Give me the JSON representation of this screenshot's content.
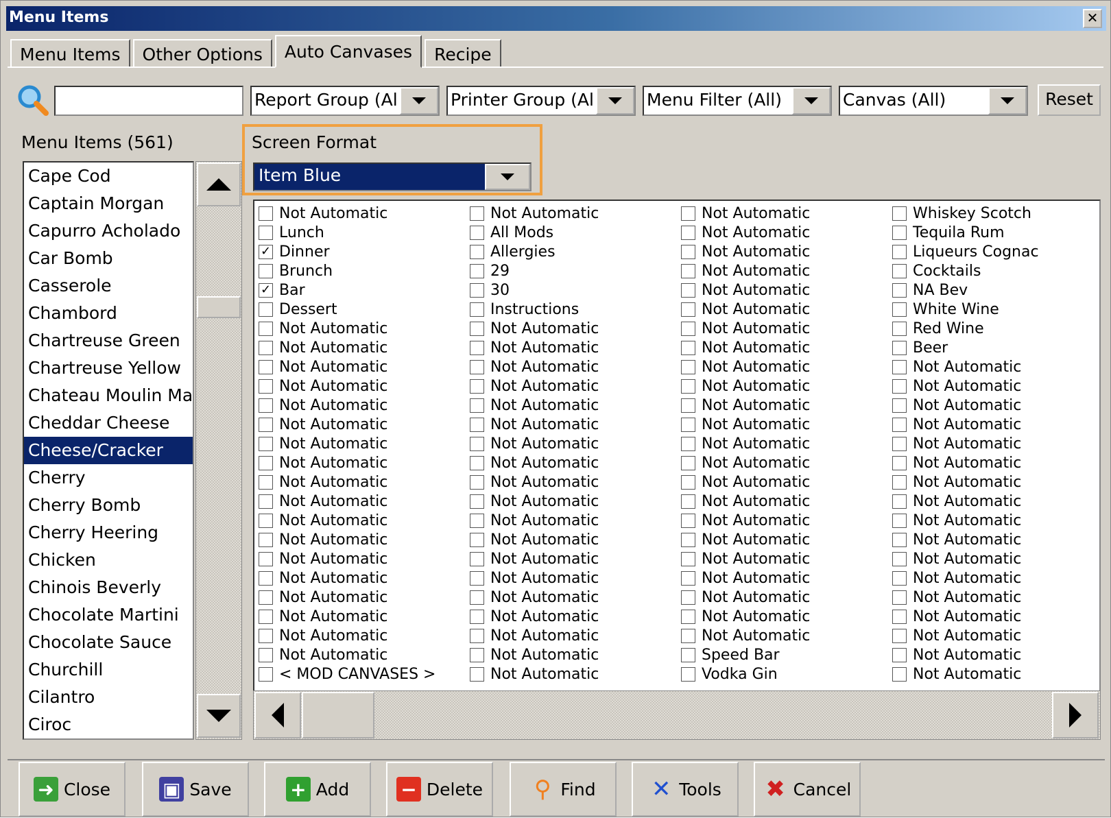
{
  "window": {
    "title": "Menu Items",
    "close_glyph": "✕"
  },
  "tabs": [
    "Menu Items",
    "Other Options",
    "Auto Canvases",
    "Recipe"
  ],
  "active_tab": "Auto Canvases",
  "filters": {
    "search_value": "",
    "report_group": "Report Group (Al",
    "printer_group": "Printer Group (Al",
    "menu_filter": "Menu Filter (All)",
    "canvas": "Canvas (All)",
    "reset": "Reset"
  },
  "menu_items_label": "Menu Items  (561)",
  "menu_items": [
    "Cape Cod",
    "Captain Morgan",
    "Capurro Acholado",
    "Car Bomb",
    "Casserole",
    "Chambord",
    "Chartreuse Green",
    "Chartreuse Yellow",
    "Chateau Moulin Marg",
    "Cheddar Cheese",
    "Cheese/Cracker",
    "Cherry",
    "Cherry Bomb",
    "Cherry Heering",
    "Chicken",
    "Chinois Beverly",
    "Chocolate Martini",
    "Chocolate Sauce",
    "Churchill",
    "Cilantro",
    "Ciroc"
  ],
  "selected_item": "Cheese/Cracker",
  "screen_format": {
    "label": "Screen Format",
    "value": "Item Blue",
    "highlight_color": "#f0a040"
  },
  "canvas_columns": [
    [
      {
        "label": "Not Automatic",
        "checked": false
      },
      {
        "label": "Lunch",
        "checked": false
      },
      {
        "label": "Dinner",
        "checked": true
      },
      {
        "label": "Brunch",
        "checked": false
      },
      {
        "label": "Bar",
        "checked": true
      },
      {
        "label": "Dessert",
        "checked": false
      },
      {
        "label": "Not Automatic",
        "checked": false
      },
      {
        "label": "Not Automatic",
        "checked": false
      },
      {
        "label": "Not Automatic",
        "checked": false
      },
      {
        "label": "Not Automatic",
        "checked": false
      },
      {
        "label": "Not Automatic",
        "checked": false
      },
      {
        "label": "Not Automatic",
        "checked": false
      },
      {
        "label": "Not Automatic",
        "checked": false
      },
      {
        "label": "Not Automatic",
        "checked": false
      },
      {
        "label": "Not Automatic",
        "checked": false
      },
      {
        "label": "Not Automatic",
        "checked": false
      },
      {
        "label": "Not Automatic",
        "checked": false
      },
      {
        "label": "Not Automatic",
        "checked": false
      },
      {
        "label": "Not Automatic",
        "checked": false
      },
      {
        "label": "Not Automatic",
        "checked": false
      },
      {
        "label": "Not Automatic",
        "checked": false
      },
      {
        "label": "Not Automatic",
        "checked": false
      },
      {
        "label": "Not Automatic",
        "checked": false
      },
      {
        "label": "Not Automatic",
        "checked": false
      },
      {
        "label": "< MOD CANVASES >",
        "checked": false
      }
    ],
    [
      {
        "label": "Not Automatic",
        "checked": false
      },
      {
        "label": "All Mods",
        "checked": false
      },
      {
        "label": "Allergies",
        "checked": false
      },
      {
        "label": "29",
        "checked": false
      },
      {
        "label": "30",
        "checked": false
      },
      {
        "label": "Instructions",
        "checked": false
      },
      {
        "label": "Not Automatic",
        "checked": false
      },
      {
        "label": "Not Automatic",
        "checked": false
      },
      {
        "label": "Not Automatic",
        "checked": false
      },
      {
        "label": "Not Automatic",
        "checked": false
      },
      {
        "label": "Not Automatic",
        "checked": false
      },
      {
        "label": "Not Automatic",
        "checked": false
      },
      {
        "label": "Not Automatic",
        "checked": false
      },
      {
        "label": "Not Automatic",
        "checked": false
      },
      {
        "label": "Not Automatic",
        "checked": false
      },
      {
        "label": "Not Automatic",
        "checked": false
      },
      {
        "label": "Not Automatic",
        "checked": false
      },
      {
        "label": "Not Automatic",
        "checked": false
      },
      {
        "label": "Not Automatic",
        "checked": false
      },
      {
        "label": "Not Automatic",
        "checked": false
      },
      {
        "label": "Not Automatic",
        "checked": false
      },
      {
        "label": "Not Automatic",
        "checked": false
      },
      {
        "label": "Not Automatic",
        "checked": false
      },
      {
        "label": "Not Automatic",
        "checked": false
      },
      {
        "label": "Not Automatic",
        "checked": false
      }
    ],
    [
      {
        "label": "Not Automatic",
        "checked": false
      },
      {
        "label": "Not Automatic",
        "checked": false
      },
      {
        "label": "Not Automatic",
        "checked": false
      },
      {
        "label": "Not Automatic",
        "checked": false
      },
      {
        "label": "Not Automatic",
        "checked": false
      },
      {
        "label": "Not Automatic",
        "checked": false
      },
      {
        "label": "Not Automatic",
        "checked": false
      },
      {
        "label": "Not Automatic",
        "checked": false
      },
      {
        "label": "Not Automatic",
        "checked": false
      },
      {
        "label": "Not Automatic",
        "checked": false
      },
      {
        "label": "Not Automatic",
        "checked": false
      },
      {
        "label": "Not Automatic",
        "checked": false
      },
      {
        "label": "Not Automatic",
        "checked": false
      },
      {
        "label": "Not Automatic",
        "checked": false
      },
      {
        "label": "Not Automatic",
        "checked": false
      },
      {
        "label": "Not Automatic",
        "checked": false
      },
      {
        "label": "Not Automatic",
        "checked": false
      },
      {
        "label": "Not Automatic",
        "checked": false
      },
      {
        "label": "Not Automatic",
        "checked": false
      },
      {
        "label": "Not Automatic",
        "checked": false
      },
      {
        "label": "Not Automatic",
        "checked": false
      },
      {
        "label": "Not Automatic",
        "checked": false
      },
      {
        "label": "Not Automatic",
        "checked": false
      },
      {
        "label": "Speed Bar",
        "checked": false
      },
      {
        "label": "Vodka Gin",
        "checked": false
      }
    ],
    [
      {
        "label": "Whiskey Scotch",
        "checked": false
      },
      {
        "label": "Tequila Rum",
        "checked": false
      },
      {
        "label": "Liqueurs Cognac",
        "checked": false
      },
      {
        "label": "Cocktails",
        "checked": false
      },
      {
        "label": "NA Bev",
        "checked": false
      },
      {
        "label": "White Wine",
        "checked": false
      },
      {
        "label": "Red Wine",
        "checked": false
      },
      {
        "label": "Beer",
        "checked": false
      },
      {
        "label": "Not Automatic",
        "checked": false
      },
      {
        "label": "Not Automatic",
        "checked": false
      },
      {
        "label": "Not Automatic",
        "checked": false
      },
      {
        "label": "Not Automatic",
        "checked": false
      },
      {
        "label": "Not Automatic",
        "checked": false
      },
      {
        "label": "Not Automatic",
        "checked": false
      },
      {
        "label": "Not Automatic",
        "checked": false
      },
      {
        "label": "Not Automatic",
        "checked": false
      },
      {
        "label": "Not Automatic",
        "checked": false
      },
      {
        "label": "Not Automatic",
        "checked": false
      },
      {
        "label": "Not Automatic",
        "checked": false
      },
      {
        "label": "Not Automatic",
        "checked": false
      },
      {
        "label": "Not Automatic",
        "checked": false
      },
      {
        "label": "Not Automatic",
        "checked": false
      },
      {
        "label": "Not Automatic",
        "checked": false
      },
      {
        "label": "Not Automatic",
        "checked": false
      },
      {
        "label": "Not Automatic",
        "checked": false
      }
    ]
  ],
  "buttons": [
    {
      "label": "Close",
      "icon": "exit-icon",
      "color": "#3aa03a"
    },
    {
      "label": "Save",
      "icon": "floppy-icon",
      "color": "#4040a0"
    },
    {
      "label": "Add",
      "icon": "plus-icon",
      "color": "#30a030"
    },
    {
      "label": "Delete",
      "icon": "minus-icon",
      "color": "#e03020"
    },
    {
      "label": "Find",
      "icon": "magnifier-icon",
      "color": "#f08020"
    },
    {
      "label": "Tools",
      "icon": "tools-icon",
      "color": "#2050d0"
    },
    {
      "label": "Cancel",
      "icon": "x-icon",
      "color": "#d02020"
    }
  ]
}
